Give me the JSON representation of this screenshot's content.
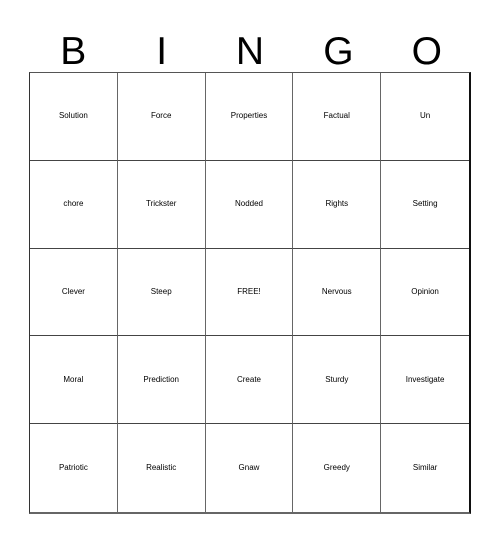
{
  "header": [
    "B",
    "I",
    "N",
    "G",
    "O"
  ],
  "cells": [
    [
      "Solution",
      "Force",
      "Properties",
      "Factual",
      "Un"
    ],
    [
      "chore",
      "Trickster",
      "Nodded",
      "Rights",
      "Setting"
    ],
    [
      "Clever",
      "Steep",
      "FREE!",
      "Nervous",
      "Opinion"
    ],
    [
      "Moral",
      "Prediction",
      "Create",
      "Sturdy",
      "Investigate"
    ],
    [
      "Patriotic",
      "Realistic",
      "Gnaw",
      "Greedy",
      "Similar"
    ]
  ]
}
